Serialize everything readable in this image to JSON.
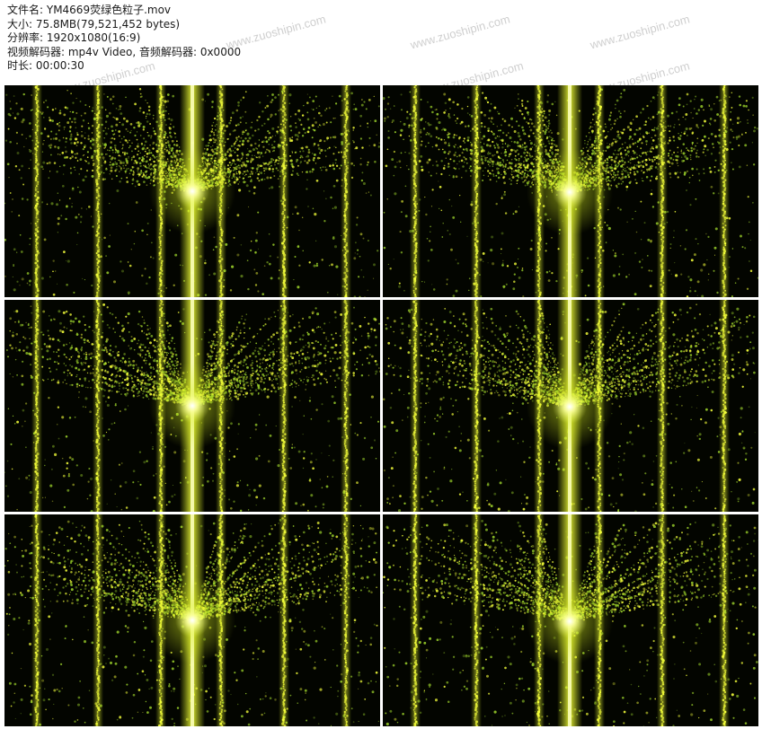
{
  "info": {
    "filename": "文件名: YM4669荧绿色粒子.mov",
    "size": "大小: 75.8MB(79,521,452 bytes)",
    "resolution": "分辨率: 1920x1080(16:9)",
    "codec": "视频解码器: mp4v Video, 音频解码器: 0x0000",
    "duration": "时长: 00:00:30"
  },
  "watermark": "www.zuoshipin.com",
  "colors": {
    "beam": "#f4ff3a",
    "glow": "#d8f020",
    "particle": "#9bd12a",
    "background": "#030500"
  },
  "thumbnails": [
    {
      "name": "frame-1",
      "variant": "a"
    },
    {
      "name": "frame-2",
      "variant": "b"
    },
    {
      "name": "frame-3",
      "variant": "a"
    },
    {
      "name": "frame-4",
      "variant": "b"
    },
    {
      "name": "frame-5",
      "variant": "a"
    },
    {
      "name": "frame-6",
      "variant": "b"
    }
  ]
}
